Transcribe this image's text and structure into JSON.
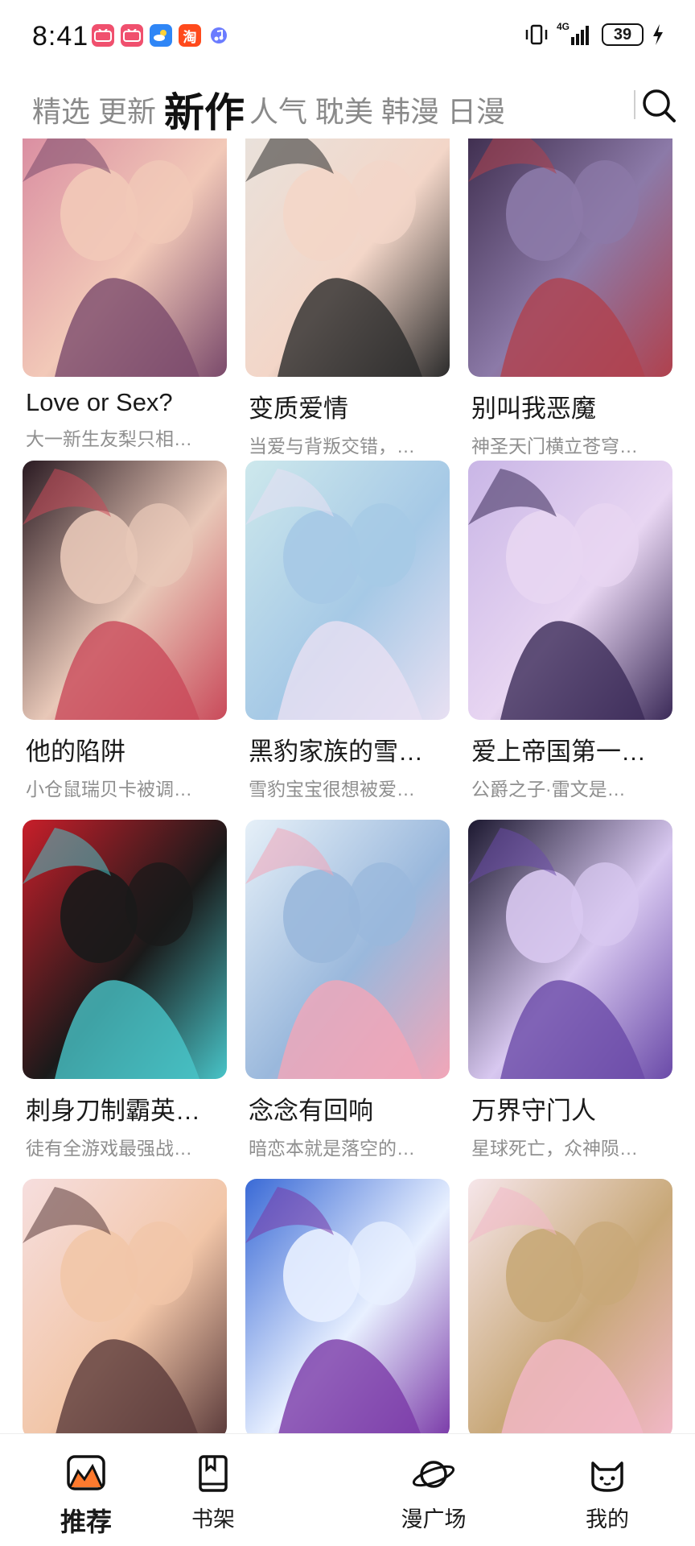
{
  "status_bar": {
    "time": "8:41",
    "app_icons": [
      {
        "name": "bilibili-comics-icon",
        "color": "#f0506e"
      },
      {
        "name": "bilibili-comics-icon",
        "color": "#f0506e"
      },
      {
        "name": "weather-icon",
        "color": "#2f86f6"
      },
      {
        "name": "taobao-icon",
        "color": "#ff4a1c",
        "label": "淘"
      },
      {
        "name": "music-icon",
        "color": "#6b7cff"
      }
    ],
    "network": "4G",
    "battery": "39"
  },
  "tabs": [
    {
      "label": "精选",
      "active": false
    },
    {
      "label": "更新",
      "active": false
    },
    {
      "label": "新作",
      "active": true
    },
    {
      "label": "人气",
      "active": false
    },
    {
      "label": "耽美",
      "active": false
    },
    {
      "label": "韩漫",
      "active": false
    },
    {
      "label": "日漫",
      "active": false
    }
  ],
  "cards": [
    {
      "title": "Love or Sex?",
      "desc": "大一新生友梨只相…",
      "palette": [
        "#d88aa0",
        "#7a4a6b",
        "#f2c9b8"
      ]
    },
    {
      "title": "变质爱情",
      "desc": "当爱与背叛交错，…",
      "palette": [
        "#e8e2dc",
        "#2b2b2b",
        "#f3d6c8"
      ]
    },
    {
      "title": "别叫我恶魔",
      "desc": "神圣天门横立苍穹…",
      "palette": [
        "#3b2a4a",
        "#b0414d",
        "#8c7aa8"
      ]
    },
    {
      "title": "他的陷阱",
      "desc": "小仓鼠瑞贝卡被调…",
      "palette": [
        "#2a1a22",
        "#c94a5a",
        "#e8c8b8"
      ]
    },
    {
      "title": "黑豹家族的雪…",
      "desc": "雪豹宝宝很想被爱…",
      "palette": [
        "#cde8ec",
        "#e8e0f2",
        "#a6c9e6"
      ]
    },
    {
      "title": "爱上帝国第一…",
      "desc": "公爵之子·雷文是…",
      "palette": [
        "#c9b6e6",
        "#3b2a58",
        "#e8d6f2"
      ]
    },
    {
      "title": "刺身刀制霸英…",
      "desc": "徒有全游戏最强战…",
      "palette": [
        "#c81e2a",
        "#48c4c8",
        "#1a1a1a"
      ]
    },
    {
      "title": "念念有回响",
      "desc": "暗恋本就是落空的…",
      "palette": [
        "#e6f0f8",
        "#f2a6b8",
        "#9ab8dc"
      ]
    },
    {
      "title": "万界守门人",
      "desc": "星球死亡，众神陨…",
      "palette": [
        "#1c1830",
        "#6a4aa8",
        "#d8c8f0"
      ]
    },
    {
      "title": "",
      "desc": "",
      "palette": [
        "#f6dede",
        "#5a3a3a",
        "#f2c6a8"
      ]
    },
    {
      "title": "",
      "desc": "",
      "palette": [
        "#3a6ad6",
        "#7a3aa8",
        "#e8f0ff"
      ]
    },
    {
      "title": "",
      "desc": "",
      "palette": [
        "#f6e6ea",
        "#f2b8c8",
        "#c8a878"
      ]
    }
  ],
  "bottom_nav": [
    {
      "label": "推荐",
      "icon": "recommend-icon",
      "active": true
    },
    {
      "label": "书架",
      "icon": "bookshelf-icon",
      "active": false
    },
    {
      "label": "漫广场",
      "icon": "planet-icon",
      "active": false
    },
    {
      "label": "我的",
      "icon": "profile-cat-icon",
      "active": false
    }
  ]
}
